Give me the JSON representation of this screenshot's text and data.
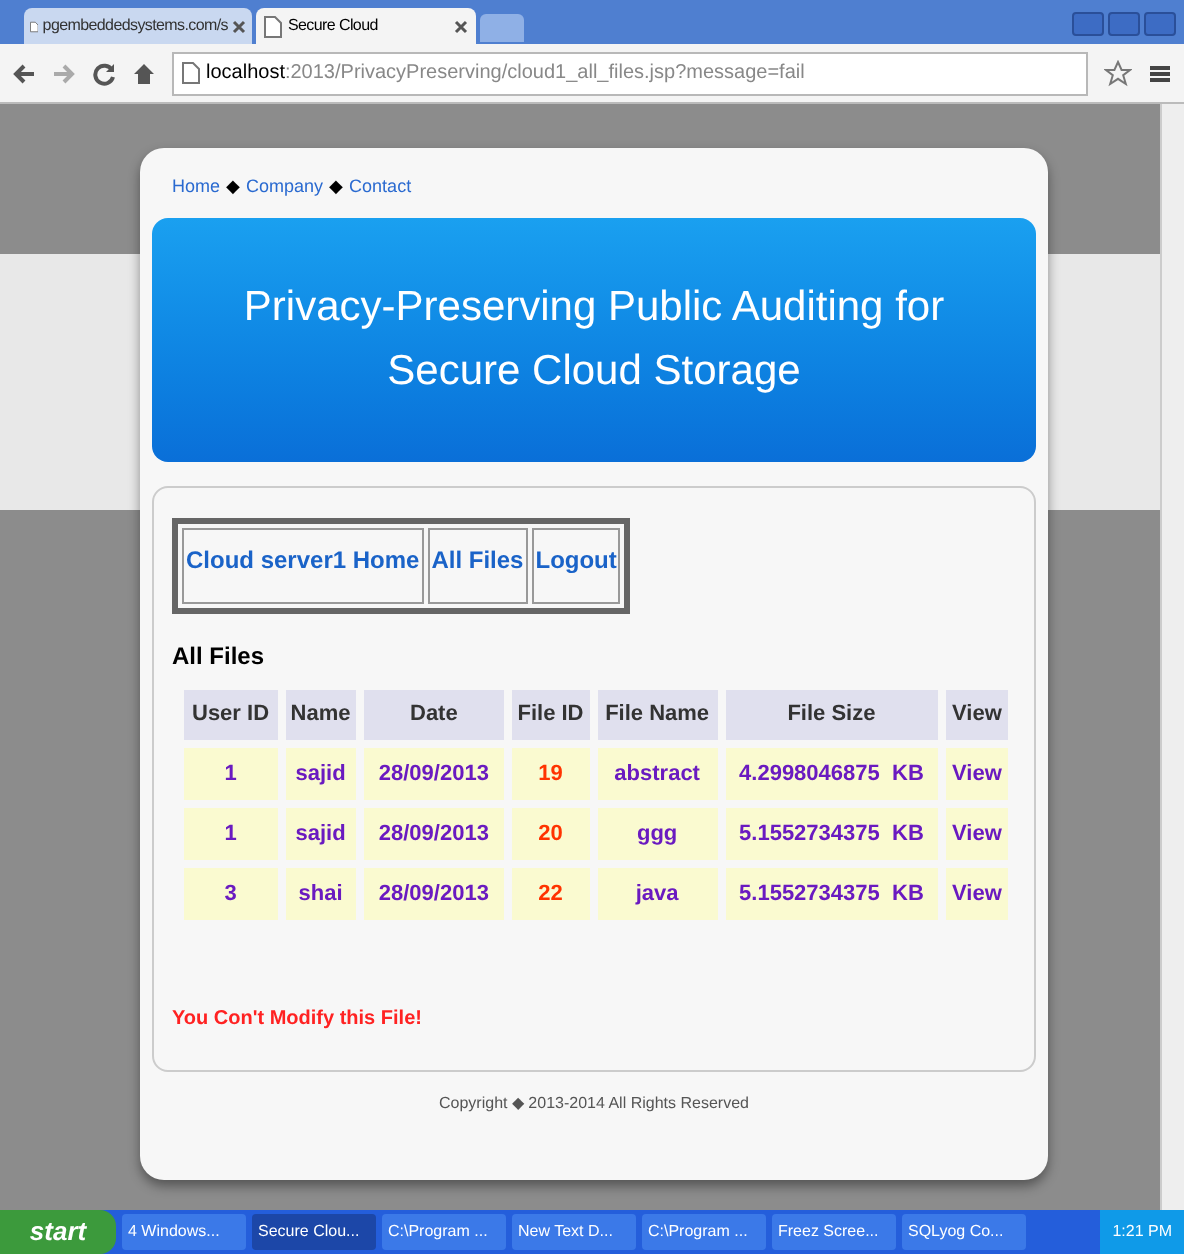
{
  "browser": {
    "tabs": [
      {
        "label": "pgembeddedsystems.com/s",
        "selected": false
      },
      {
        "label": "Secure Cloud",
        "selected": true
      }
    ],
    "address": {
      "host": "localhost",
      "path": ":2013/PrivacyPreserving/cloud1_all_files.jsp?message=fail"
    }
  },
  "page": {
    "top_links": [
      {
        "label": "Home"
      },
      {
        "label": "Company"
      },
      {
        "label": "Contact"
      }
    ],
    "link_separator": "◆",
    "banner_title": "Privacy-Preserving Public Auditing for Secure Cloud Storage",
    "nav": [
      "Cloud server1 Home",
      "All Files",
      "Logout"
    ],
    "section_title": "All Files",
    "table": {
      "columns": [
        "User ID",
        "Name",
        "Date",
        "File ID",
        "File Name",
        "File Size",
        "View"
      ],
      "rows": [
        [
          "1",
          "sajid",
          "28/09/2013",
          "19",
          "abstract",
          "4.2998046875  KB",
          "View"
        ],
        [
          "1",
          "sajid",
          "28/09/2013",
          "20",
          "ggg",
          "5.1552734375  KB",
          "View"
        ],
        [
          "3",
          "shai",
          "28/09/2013",
          "22",
          "java",
          "5.1552734375  KB",
          "View"
        ]
      ]
    },
    "message": "You Con't Modify this File!",
    "footer": "Copyright ◆ 2013-2014 All Rights Reserved"
  },
  "taskbar": {
    "start": "start",
    "items": [
      {
        "label": "4 Windows...",
        "selected": false
      },
      {
        "label": "Secure Clou...",
        "selected": true
      },
      {
        "label": "C:\\Program ...",
        "selected": false
      },
      {
        "label": "New Text D...",
        "selected": false
      },
      {
        "label": "C:\\Program ...",
        "selected": false
      },
      {
        "label": "Freez Scree...",
        "selected": false
      },
      {
        "label": "SQLyog Co...",
        "selected": false
      }
    ],
    "clock": "1:21 PM"
  }
}
